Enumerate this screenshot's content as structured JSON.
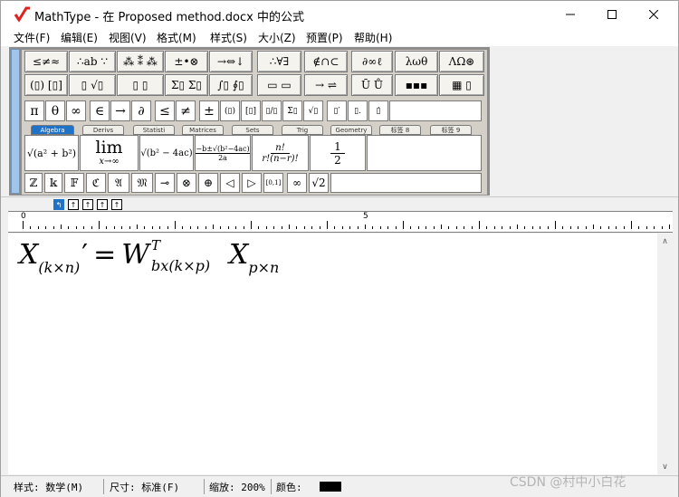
{
  "window": {
    "title": "MathType - 在 Proposed method.docx 中的公式",
    "controls": [
      "minimize-icon",
      "maximize-icon",
      "close-icon"
    ]
  },
  "menu": [
    {
      "label": "文件(F)"
    },
    {
      "label": "编辑(E)"
    },
    {
      "label": "视图(V)"
    },
    {
      "label": "格式(M)"
    },
    {
      "label": "样式(S)"
    },
    {
      "label": "大小(Z)"
    },
    {
      "label": "预置(P)"
    },
    {
      "label": "帮助(H)"
    }
  ],
  "palette": {
    "row1": [
      "≤≠≈",
      "∴ab ∵",
      "⁂ ⁑ ⁂",
      "±•⊗",
      "→⇔↓",
      "∴∀∃",
      "∉∩⊂",
      "∂∞ℓ",
      "λωθ",
      "ΛΩ⊛"
    ],
    "row2": [
      "(▯) [▯]",
      "▯ √▯",
      "▯ ▯",
      "Σ▯ Σ▯",
      "∫▯ ∮▯",
      "▭ ▭",
      "→ ⇌",
      "Ū Ů",
      "▪▪▪",
      "▦ ▯"
    ],
    "symbols": [
      "π",
      "θ",
      "∞",
      "∈",
      "→",
      "∂",
      "≤",
      "≠",
      "±",
      "(▯)",
      "[▯]",
      "▯/▯",
      "Σ▯",
      "√▯",
      "▯′",
      "▯.",
      "▯̇"
    ],
    "tabs": [
      {
        "label": "Algebra",
        "active": true
      },
      {
        "label": "Derivs",
        "active": false
      },
      {
        "label": "Statisti",
        "active": false
      },
      {
        "label": "Matrices",
        "active": false
      },
      {
        "label": "Sets",
        "active": false
      },
      {
        "label": "Trig",
        "active": false
      },
      {
        "label": "Geometry",
        "active": false
      },
      {
        "label": "标签 8",
        "active": false
      },
      {
        "label": "标签 9",
        "active": false
      }
    ],
    "templates": {
      "sqrt_sum": "√(a² + b²)",
      "lim_word": "lim",
      "lim_sub": "x→∞",
      "sqrt_disc": "√(b² − 4ac)",
      "quadratic_num": "−b±√(b²−4ac)",
      "quadratic_den": "2a",
      "perm_num": "n!",
      "perm_den": "r!(n−r)!",
      "half_num": "1",
      "half_den": "2"
    },
    "bottom_row": [
      "ℤ",
      "𝕜",
      "𝔽",
      "ℭ",
      "𝔄",
      "𝔐",
      "⊸",
      "⊗",
      "⊕",
      "◁",
      "▷",
      "[0,1]",
      "∞",
      "√2"
    ]
  },
  "slots": [
    "↰",
    "↑",
    "↑",
    "↑",
    "↑"
  ],
  "ruler": {
    "labels": [
      "0",
      "5"
    ]
  },
  "equation": {
    "X1": "X",
    "X1_sub": "(k×n)",
    "prime": "′",
    "equals": "=",
    "W": "W",
    "W_sup": "T",
    "W_sub": "bx(k×p)",
    "X2": "X",
    "X2_sub": "p×n"
  },
  "status": {
    "style": "样式: 数学(M)",
    "size": "尺寸: 标准(F)",
    "zoom": "缩放: 200%",
    "color_label": "颜色:",
    "color_value": "#000000"
  },
  "watermark": "CSDN @村中小白花"
}
